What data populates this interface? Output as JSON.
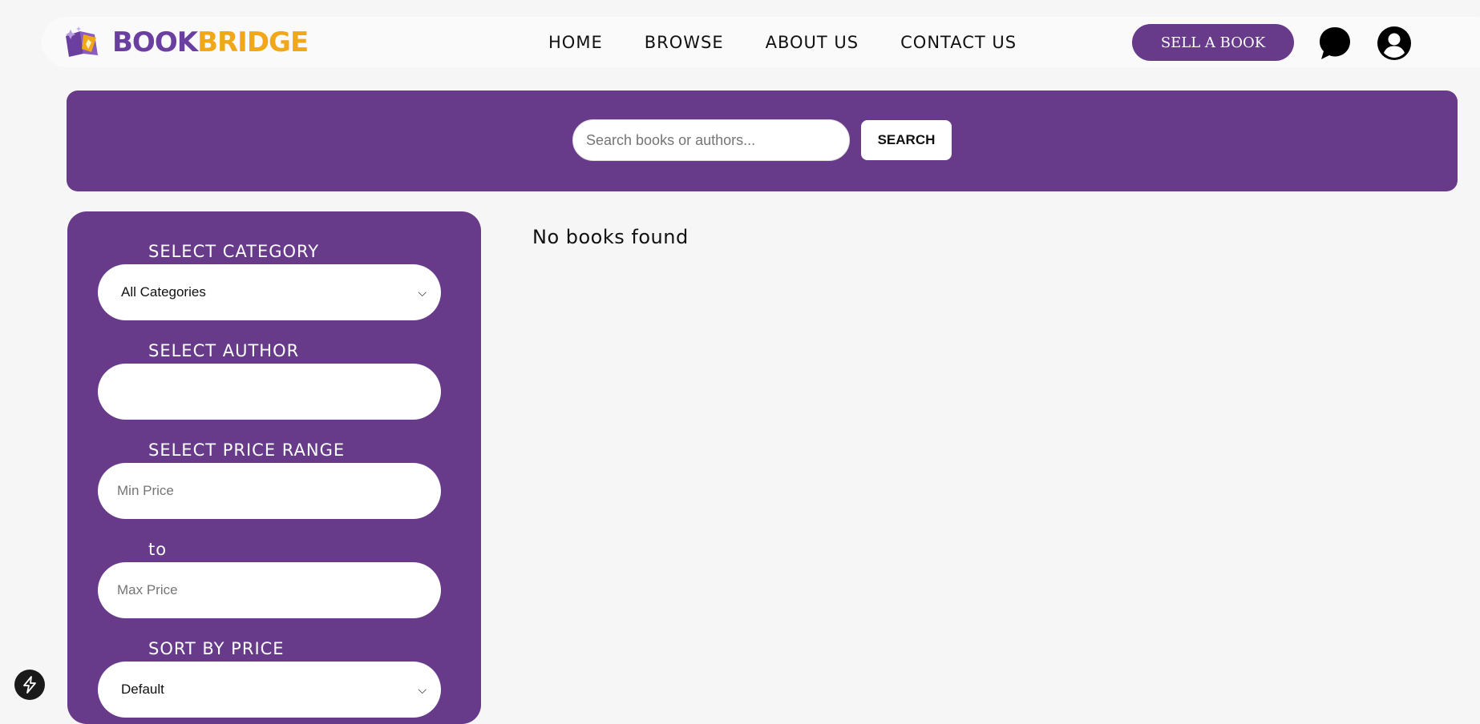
{
  "brand": {
    "part1": "BOOK",
    "part2": "BRIDGE",
    "color_primary": "#6b3fa0",
    "color_accent": "#f0a818"
  },
  "nav": {
    "links": [
      "HOME",
      "BROWSE",
      "ABOUT US",
      "CONTACT US"
    ],
    "sell_label": "SELL A BOOK",
    "icons": [
      "chat-bubble-icon",
      "user-account-icon"
    ]
  },
  "search": {
    "placeholder": "Search books or authors...",
    "value": "",
    "button_label": "SEARCH"
  },
  "filters": {
    "category_label": "SELECT CATEGORY",
    "category_value": "All Categories",
    "author_label": "SELECT AUTHOR",
    "author_value": "",
    "price_label": "SELECT PRICE RANGE",
    "min_placeholder": "Min Price",
    "to_label": "to",
    "max_placeholder": "Max Price",
    "sort_label": "SORT BY PRICE",
    "sort_value": "Default"
  },
  "results": {
    "message": "No books found"
  },
  "theme": {
    "purple": "#673a8a",
    "background": "#f6f6f6"
  },
  "floating": {
    "icon": "lightning-bolt-icon"
  }
}
